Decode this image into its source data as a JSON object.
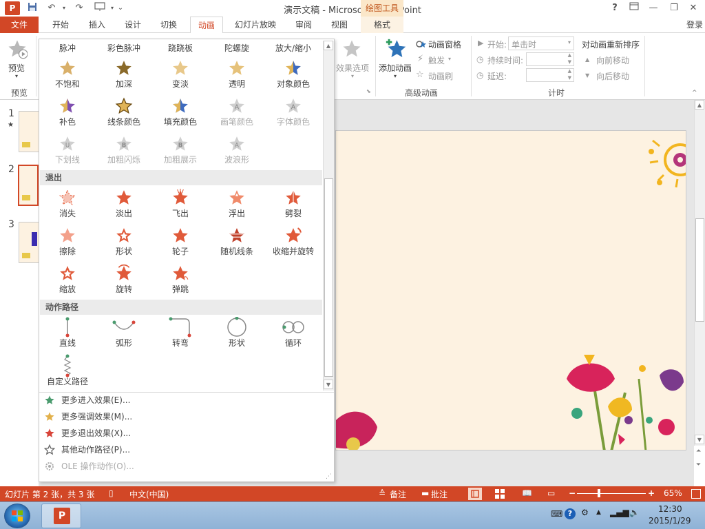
{
  "window": {
    "title": "演示文稿 - Microsoft PowerPoint",
    "context_group": "绘图工具",
    "help": "?",
    "login": "登录",
    "accent_color": "#d24726"
  },
  "tabs": {
    "file": "文件",
    "home": "开始",
    "insert": "插入",
    "design": "设计",
    "transitions": "切换",
    "animations": "动画",
    "slideshow": "幻灯片放映",
    "review": "审阅",
    "view": "视图",
    "format": "格式"
  },
  "ribbon": {
    "preview_btn": "预览",
    "preview_group": "预览",
    "effect_options": "效果选项",
    "add_animation": "添加动画",
    "animation_pane": "动画窗格",
    "trigger": "触发",
    "animation_painter": "动画刷",
    "advanced_group": "高级动画",
    "start_label": "开始:",
    "start_value": "单击时",
    "duration_label": "持续时间:",
    "delay_label": "延迟:",
    "timing_group": "计时",
    "reorder_title": "对动画重新排序",
    "move_earlier": "向前移动",
    "move_later": "向后移动"
  },
  "gallery": {
    "emphasis_top_row": [
      "脉冲",
      "彩色脉冲",
      "跷跷板",
      "陀螺旋",
      "放大/缩小"
    ],
    "emphasis_rows": [
      [
        "不饱和",
        "加深",
        "变淡",
        "透明",
        "对象颜色"
      ],
      [
        "补色",
        "线条颜色",
        "填充颜色",
        "画笔颜色",
        "字体颜色"
      ],
      [
        "下划线",
        "加粗闪烁",
        "加粗展示",
        "波浪形"
      ]
    ],
    "exit_header": "退出",
    "exit_rows": [
      [
        "消失",
        "淡出",
        "飞出",
        "浮出",
        "劈裂"
      ],
      [
        "擦除",
        "形状",
        "轮子",
        "随机线条",
        "收缩并旋转"
      ],
      [
        "缩放",
        "旋转",
        "弹跳"
      ]
    ],
    "path_header": "动作路径",
    "path_rows": [
      [
        "直线",
        "弧形",
        "转弯",
        "形状",
        "循环"
      ],
      [
        "自定义路径"
      ]
    ],
    "menu": [
      {
        "label": "更多进入效果(E)...",
        "icon": "green-star-icon",
        "color": "#4a9b6e"
      },
      {
        "label": "更多强调效果(M)...",
        "icon": "gold-star-icon",
        "color": "#e2b04a"
      },
      {
        "label": "更多退出效果(X)...",
        "icon": "red-star-icon",
        "color": "#d8453a"
      },
      {
        "label": "其他动作路径(P)...",
        "icon": "outline-star-icon",
        "color": "#666666"
      },
      {
        "label": "OLE 操作动作(O)...",
        "icon": "gear-icon",
        "color": "#aaaaaa"
      }
    ]
  },
  "slides": {
    "numbers": [
      "1",
      "2",
      "3"
    ],
    "selected": "2",
    "first_marker": "★"
  },
  "status": {
    "slide_info": "幻灯片 第 2 张，共 3 张",
    "language": "中文(中国)",
    "notes": "备注",
    "comments": "批注",
    "minus": "−",
    "plus": "+",
    "zoom": "65%"
  },
  "taskbar": {
    "time": "12:30",
    "date": "2015/1/29"
  }
}
